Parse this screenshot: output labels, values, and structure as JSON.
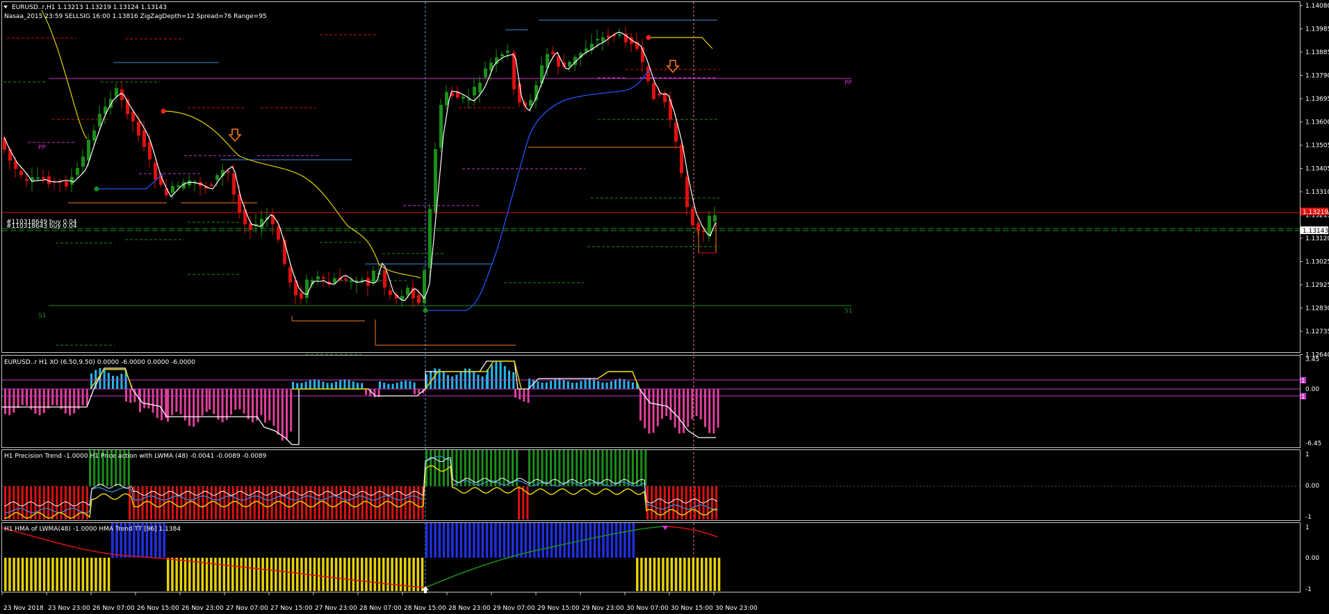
{
  "main": {
    "title": "EURUSD..r,H1  1.13213 1.13219 1.13124 1.13143",
    "subtitle": "Nasaa_2015  23:59  SELLSIG  16:00  1.13816  ZigZagDepth=12  Spread=76  Range=95",
    "price_ticks": [
      "1.14080",
      "1.13985",
      "1.13885",
      "1.13790",
      "1.13695",
      "1.13600",
      "1.13505",
      "1.13405",
      "1.13310",
      "1.13215",
      "1.13120",
      "1.13025",
      "1.12925",
      "1.12830",
      "1.12735",
      "1.12640"
    ],
    "current_bid": "1.13143",
    "current_ask": "1.13219",
    "order_label_1": "#110318649 buy 0.04",
    "order_label_2": "#110318643 buy 0.04",
    "pivot_pp": "PP",
    "pivot_s1": "S1"
  },
  "xo": {
    "title": "EURUSD..r H1 XO (6.50,9.50) 0.0000 -6.0000 0.0000 -6.0000",
    "ticks": [
      "3.45",
      "0.00",
      "-6.45"
    ],
    "badges": [
      "1",
      "1"
    ]
  },
  "precision": {
    "title": "H1 Precision Trend -1.0000  H1 Price action with LWMA (48) -0.0041 -0.0089 -0.0089",
    "ticks": [
      "1",
      "0.00",
      "-1"
    ]
  },
  "hma": {
    "title": "H1 HMA of LWMA(48) -1.0000  HMA Trend TT [96] 1.1384",
    "ticks": [
      "1",
      "0.00",
      "-1"
    ]
  },
  "time_axis": [
    "23 Nov 2018",
    "23 Nov 23:00",
    "26 Nov 07:00",
    "26 Nov 15:00",
    "26 Nov 23:00",
    "27 Nov 07:00",
    "27 Nov 15:00",
    "27 Nov 23:00",
    "28 Nov 07:00",
    "28 Nov 15:00",
    "28 Nov 23:00",
    "29 Nov 07:00",
    "29 Nov 15:00",
    "29 Nov 23:00",
    "30 Nov 07:00",
    "30 Nov 15:00",
    "30 Nov 23:00"
  ],
  "colors": {
    "bull": "#1a8f1a",
    "bear": "#e01010",
    "pp": "#cc33cc",
    "s1": "#1a8f1a",
    "accent_blue": "#2255ff"
  }
}
